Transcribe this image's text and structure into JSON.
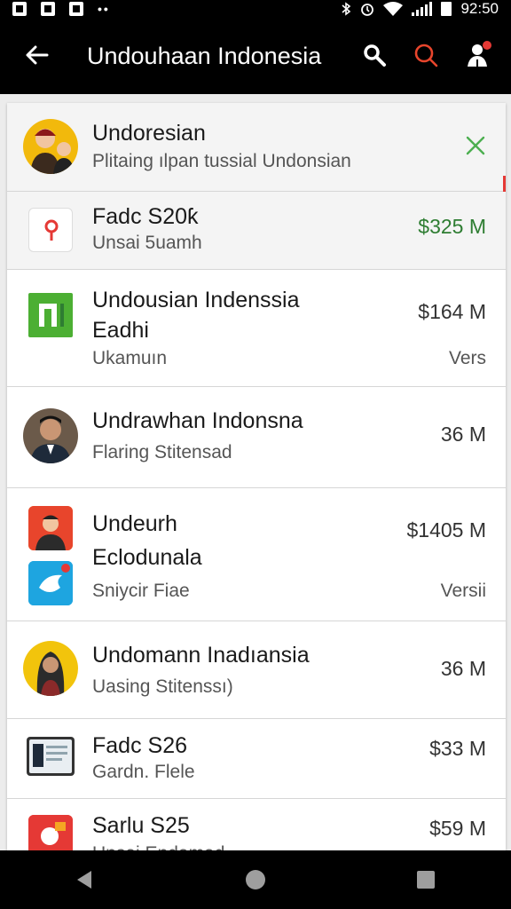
{
  "status_bar": {
    "time": "92:50"
  },
  "app_bar": {
    "title": "Undouhaan Indonesia",
    "back_icon": "arrow-back-icon",
    "actions": [
      "search-icon",
      "search-icon-accent",
      "account-icon"
    ]
  },
  "colors": {
    "accent": "#e8452c",
    "price_green": "#2e7d32",
    "badge_red": "#e53935"
  },
  "list": {
    "items": [
      {
        "title": "Undoresian",
        "subtitle": "Plitaing ılpan tussial Undonsian",
        "icon": "portrait-avatar",
        "action": "close-icon"
      },
      {
        "title": "Fadc S20ƙ",
        "subtitle": "Unsai 5uamh",
        "price": "$325 M",
        "icon": "red-p-app-icon"
      },
      {
        "title": "Undousian Indenssia",
        "title2": "Eadhi",
        "subtitle": "Ukamuın",
        "price": "$164 M",
        "meta": "Vers",
        "icon": "green-n-app-icon"
      },
      {
        "title": "Undrawhan Indonsna",
        "subtitle": "Flaring Stitensad",
        "price": "36 M",
        "icon": "portrait-avatar"
      },
      {
        "title": "Undeurh",
        "title2": "Eclodunala",
        "subtitle": "Sniycir Fiae",
        "price": "$1405 M",
        "meta": "Versii",
        "icon": "dual-app-icons"
      },
      {
        "title": "Undomann Inadıansia",
        "subtitle": "Uasing Stitenssı)",
        "price": "36 M",
        "icon": "portrait-avatar"
      },
      {
        "title": "Fadc S26",
        "subtitle": "Gardn. Flele",
        "price": "$33 M",
        "icon": "tablet-app-icon"
      },
      {
        "title": "Sarlu S25",
        "subtitle": "Unsai Endamad",
        "price": "$59 M",
        "icon": "red-app-icon"
      }
    ]
  },
  "nav_bar": {
    "buttons": [
      "back-triangle-icon",
      "home-circle-icon",
      "recents-square-icon"
    ]
  }
}
